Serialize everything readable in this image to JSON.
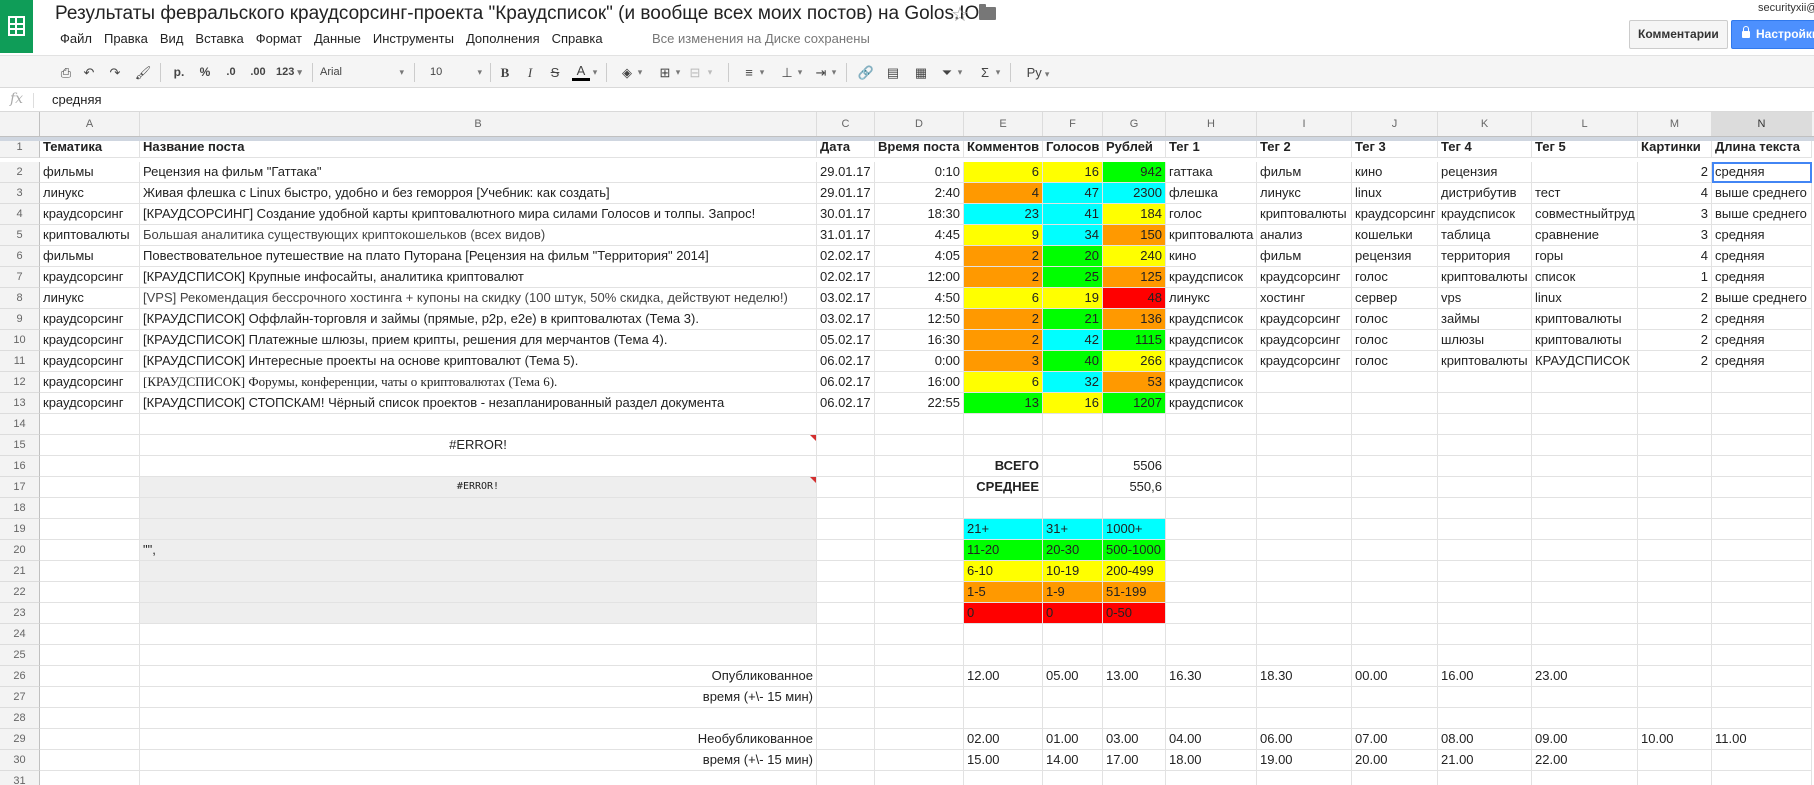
{
  "header": {
    "title": "Результаты февральского краудсорсинг-проекта \"Краудсписок\" (и вообще всех моих постов) на Golos.IO",
    "star_icon": "star-icon",
    "folder_icon": "folder-icon",
    "menu": [
      "Файл",
      "Правка",
      "Вид",
      "Вставка",
      "Формат",
      "Данные",
      "Инструменты",
      "Дополнения",
      "Справка"
    ],
    "save_status": "Все изменения на Диске сохранены",
    "user_email": "securityxii@",
    "comments_label": "Комментарии",
    "settings_label": "Настройки"
  },
  "toolbar": {
    "currency": "р.",
    "percent": "%",
    "dec_less": ".0",
    "dec_more": ".00",
    "format_123": "123",
    "font": "Arial",
    "font_size": "10",
    "lang": "Ру"
  },
  "formula_bar": {
    "fx": "fx",
    "value": "средняя"
  },
  "columns": [
    "A",
    "B",
    "C",
    "D",
    "E",
    "F",
    "G",
    "H",
    "I",
    "J",
    "K",
    "L",
    "M",
    "N"
  ],
  "colors": {
    "cyan": "#00ffff",
    "green": "#00ff00",
    "yellow": "#ffff00",
    "orange": "#ff9900",
    "red": "#ff0000",
    "selection_blue": "#4285f4"
  },
  "rows": [
    {
      "n": "1",
      "cells": [
        "Тематика",
        "Название поста",
        "Дата",
        "Время поста",
        "Комментов",
        "Голосов",
        "Рублей",
        "Тег 1",
        "Тег 2",
        "Тег 3",
        "Тег 4",
        "Тег 5",
        "Картинки",
        "Длина текста"
      ]
    },
    {
      "n": "2",
      "cells": [
        "фильмы",
        "Рецензия на фильм \"Гаттака\"",
        "29.01.17",
        "0:10",
        "6",
        "16",
        "942",
        "гаттака",
        "фильм",
        "кино",
        "рецензия",
        "",
        "2",
        "средняя"
      ]
    },
    {
      "n": "3",
      "cells": [
        "линукс",
        "Живая флешка с Linux быстро, удобно и без геморроя [Учебник: как создать]",
        "29.01.17",
        "2:40",
        "4",
        "47",
        "2300",
        "флешка",
        "линукс",
        "linux",
        "дистрибутив",
        "тест",
        "4",
        "выше среднего"
      ]
    },
    {
      "n": "4",
      "cells": [
        "краудсорсинг",
        "[КРАУДСОРСИНГ] Создание удобной карты криптовалютного мира силами Голосов и толпы. Запрос!",
        "30.01.17",
        "18:30",
        "23",
        "41",
        "184",
        "голос",
        "криптовалюты",
        "краудсорсинг",
        "краудсписок",
        "совместныйтруд",
        "3",
        "выше среднего"
      ]
    },
    {
      "n": "5",
      "cells": [
        "криптовалюты",
        "Большая аналитика существующих криптокошельков (всех видов)",
        "31.01.17",
        "4:45",
        "9",
        "34",
        "150",
        "криптовалюта",
        "анализ",
        "кошельки",
        "таблица",
        "сравнение",
        "3",
        "средняя"
      ]
    },
    {
      "n": "6",
      "cells": [
        "фильмы",
        "Повествовательное путешествие на плато Путорана [Рецензия на фильм \"Территория\" 2014]",
        "02.02.17",
        "4:05",
        "2",
        "20",
        "240",
        "кино",
        "фильм",
        "рецензия",
        "территория",
        "горы",
        "4",
        "средняя"
      ]
    },
    {
      "n": "7",
      "cells": [
        "краудсорсинг",
        "[КРАУДСПИСОК] Крупные инфосайты, аналитика криптовалют",
        "02.02.17",
        "12:00",
        "2",
        "25",
        "125",
        "краудсписок",
        "краудсорсинг",
        "голос",
        "криптовалюты",
        "список",
        "1",
        "средняя"
      ]
    },
    {
      "n": "8",
      "cells": [
        "линукс",
        "[VPS] Рекомендация бессрочного хостинга + купоны на скидку (100 штук, 50% скидка, действуют неделю!)",
        "03.02.17",
        "4:50",
        "6",
        "19",
        "48",
        "линукс",
        "хостинг",
        "сервер",
        "vps",
        "linux",
        "2",
        "выше среднего"
      ]
    },
    {
      "n": "9",
      "cells": [
        "краудсорсинг",
        "[КРАУДСПИСОК] Оффлайн-торговля и займы (прямые, p2p, e2e) в криптовалютах (Тема 3).",
        "03.02.17",
        "12:50",
        "2",
        "21",
        "136",
        "краудсписок",
        "краудсорсинг",
        "голос",
        "займы",
        "криптовалюты",
        "2",
        "средняя"
      ]
    },
    {
      "n": "10",
      "cells": [
        "краудсорсинг",
        "[КРАУДСПИСОК] Платежные шлюзы, прием крипты, решения для мерчантов (Тема 4).",
        "05.02.17",
        "16:30",
        "2",
        "42",
        "1115",
        "краудсписок",
        "краудсорсинг",
        "голос",
        "шлюзы",
        "криптовалюты",
        "2",
        "средняя"
      ]
    },
    {
      "n": "11",
      "cells": [
        "краудсорсинг",
        "[КРАУДСПИСОК] Интересные проекты на основе криптовалют (Тема 5).",
        "06.02.17",
        "0:00",
        "3",
        "40",
        "266",
        "краудсписок",
        "краудсорсинг",
        "голос",
        "криптовалюты",
        "КРАУДСПИСОК",
        "2",
        "средняя"
      ]
    },
    {
      "n": "12",
      "cells": [
        "краудсорсинг",
        "[КРАУДСПИСОК] Форумы, конференции, чаты о криптовалютах (Тема 6).",
        "06.02.17",
        "16:00",
        "6",
        "32",
        "53",
        "краудсписок",
        "",
        "",
        "",
        "",
        "",
        ""
      ]
    },
    {
      "n": "13",
      "cells": [
        "краудсорсинг",
        "[КРАУДСПИСОК] СТОПСКАМ! Чёрный список проектов - незапланированный раздел документа",
        "06.02.17",
        "22:55",
        "13",
        "16",
        "1207",
        "краудсписок",
        "",
        "",
        "",
        "",
        "",
        ""
      ]
    },
    {
      "n": "14",
      "cells": [
        "",
        "",
        "",
        "",
        "",
        "",
        "",
        "",
        "",
        "",
        "",
        "",
        "",
        ""
      ]
    },
    {
      "n": "15",
      "cells": [
        "",
        "#ERROR!",
        "",
        "",
        "",
        "",
        "",
        "",
        "",
        "",
        "",
        "",
        "",
        ""
      ]
    },
    {
      "n": "16",
      "cells": [
        "",
        "",
        "",
        "",
        "ВСЕГО",
        "",
        "5506",
        "",
        "",
        "",
        "",
        "",
        "",
        ""
      ]
    },
    {
      "n": "17",
      "cells": [
        "",
        "#ERROR!",
        "",
        "",
        "СРЕДНЕЕ",
        "",
        "550,6",
        "",
        "",
        "",
        "",
        "",
        "",
        ""
      ]
    },
    {
      "n": "18",
      "cells": [
        "",
        "",
        "",
        "",
        "",
        "",
        "",
        "",
        "",
        "",
        "",
        "",
        "",
        ""
      ]
    },
    {
      "n": "19",
      "cells": [
        "",
        "",
        "",
        "",
        "21+",
        "31+",
        "1000+",
        "",
        "",
        "",
        "",
        "",
        "",
        ""
      ]
    },
    {
      "n": "20",
      "cells": [
        "",
        "\"\",",
        "",
        "",
        "11-20",
        "20-30",
        "500-1000",
        "",
        "",
        "",
        "",
        "",
        "",
        ""
      ]
    },
    {
      "n": "21",
      "cells": [
        "",
        "",
        "",
        "",
        "6-10",
        "10-19",
        "200-499",
        "",
        "",
        "",
        "",
        "",
        "",
        ""
      ]
    },
    {
      "n": "22",
      "cells": [
        "",
        "",
        "",
        "",
        "1-5",
        "1-9",
        "51-199",
        "",
        "",
        "",
        "",
        "",
        "",
        ""
      ]
    },
    {
      "n": "23",
      "cells": [
        "",
        "",
        "",
        "",
        "0",
        "0",
        "0-50",
        "",
        "",
        "",
        "",
        "",
        "",
        ""
      ]
    },
    {
      "n": "24",
      "cells": [
        "",
        "",
        "",
        "",
        "",
        "",
        "",
        "",
        "",
        "",
        "",
        "",
        "",
        ""
      ]
    },
    {
      "n": "25",
      "cells": [
        "",
        "",
        "",
        "",
        "",
        "",
        "",
        "",
        "",
        "",
        "",
        "",
        "",
        ""
      ]
    },
    {
      "n": "26",
      "cells": [
        "",
        "Опубликованное",
        "",
        "",
        "12.00",
        "05.00",
        "13.00",
        "16.30",
        "18.30",
        "00.00",
        "16.00",
        "23.00",
        "",
        ""
      ]
    },
    {
      "n": "27",
      "cells": [
        "",
        "время (+\\- 15 мин)",
        "",
        "",
        "",
        "",
        "",
        "",
        "",
        "",
        "",
        "",
        "",
        ""
      ]
    },
    {
      "n": "28",
      "cells": [
        "",
        "",
        "",
        "",
        "",
        "",
        "",
        "",
        "",
        "",
        "",
        "",
        "",
        ""
      ]
    },
    {
      "n": "29",
      "cells": [
        "",
        "Необубликованное",
        "",
        "",
        "02.00",
        "01.00",
        "03.00",
        "04.00",
        "06.00",
        "07.00",
        "08.00",
        "09.00",
        "10.00",
        "11.00"
      ]
    },
    {
      "n": "30",
      "cells": [
        "",
        "время (+\\- 15 мин)",
        "",
        "",
        "15.00",
        "14.00",
        "17.00",
        "18.00",
        "19.00",
        "20.00",
        "21.00",
        "22.00",
        "",
        ""
      ]
    },
    {
      "n": "31",
      "cells": [
        "",
        "",
        "",
        "",
        "",
        "",
        "",
        "",
        "",
        "",
        "",
        "",
        "",
        ""
      ]
    }
  ],
  "cell_fills": {
    "2": {
      "E": "yellow",
      "F": "yellow",
      "G": "green"
    },
    "3": {
      "E": "orange",
      "F": "cyan",
      "G": "cyan"
    },
    "4": {
      "E": "cyan",
      "F": "cyan",
      "G": "yellow"
    },
    "5": {
      "E": "yellow",
      "F": "cyan",
      "G": "orange"
    },
    "6": {
      "E": "orange",
      "F": "green",
      "G": "yellow"
    },
    "7": {
      "E": "orange",
      "F": "green",
      "G": "orange"
    },
    "8": {
      "E": "yellow",
      "F": "yellow",
      "G": "red"
    },
    "9": {
      "E": "orange",
      "F": "green",
      "G": "orange"
    },
    "10": {
      "E": "orange",
      "F": "cyan",
      "G": "green"
    },
    "11": {
      "E": "orange",
      "F": "green",
      "G": "yellow"
    },
    "12": {
      "E": "yellow",
      "F": "cyan",
      "G": "orange"
    },
    "13": {
      "E": "green",
      "F": "yellow",
      "G": "green"
    },
    "19": {
      "E": "cyan",
      "F": "cyan",
      "G": "cyan"
    },
    "20": {
      "E": "green",
      "F": "green",
      "G": "green"
    },
    "21": {
      "E": "yellow",
      "F": "yellow",
      "G": "yellow"
    },
    "22": {
      "E": "orange",
      "F": "orange",
      "G": "orange"
    },
    "23": {
      "E": "red",
      "F": "red",
      "G": "red"
    }
  },
  "active_cell": "N2"
}
